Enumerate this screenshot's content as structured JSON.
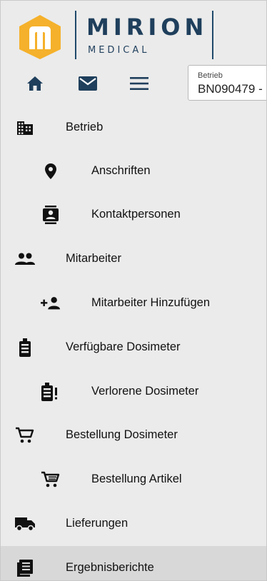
{
  "brand": {
    "name": "MIRION",
    "sub": "MEDICAL",
    "logo_color": "#F5B12B",
    "text_color": "#1F3F5C"
  },
  "header": {
    "nav_icons": [
      "home-icon",
      "mail-icon",
      "menu-icon"
    ],
    "betrieb_label": "Betrieb",
    "betrieb_value": "BN090479 -"
  },
  "menu": {
    "items": [
      {
        "label": "Betrieb",
        "icon": "building-icon",
        "level": 1
      },
      {
        "label": "Anschriften",
        "icon": "location-pin-icon",
        "level": 2
      },
      {
        "label": "Kontaktpersonen",
        "icon": "contact-card-icon",
        "level": 2
      },
      {
        "label": "Mitarbeiter",
        "icon": "people-icon",
        "level": 1
      },
      {
        "label": "Mitarbeiter Hinzufügen",
        "icon": "add-person-icon",
        "level": 2
      },
      {
        "label": "Verfügbare Dosimeter",
        "icon": "dosimeter-icon",
        "level": 1
      },
      {
        "label": "Verlorene Dosimeter",
        "icon": "dosimeter-alert-icon",
        "level": 2
      },
      {
        "label": "Bestellung Dosimeter",
        "icon": "cart-icon",
        "level": 1
      },
      {
        "label": "Bestellung Artikel",
        "icon": "cart-icon",
        "level": 2
      },
      {
        "label": "Lieferungen",
        "icon": "truck-icon",
        "level": 1
      },
      {
        "label": "Ergebnisberichte",
        "icon": "report-icon",
        "level": 1,
        "active": true
      }
    ]
  }
}
